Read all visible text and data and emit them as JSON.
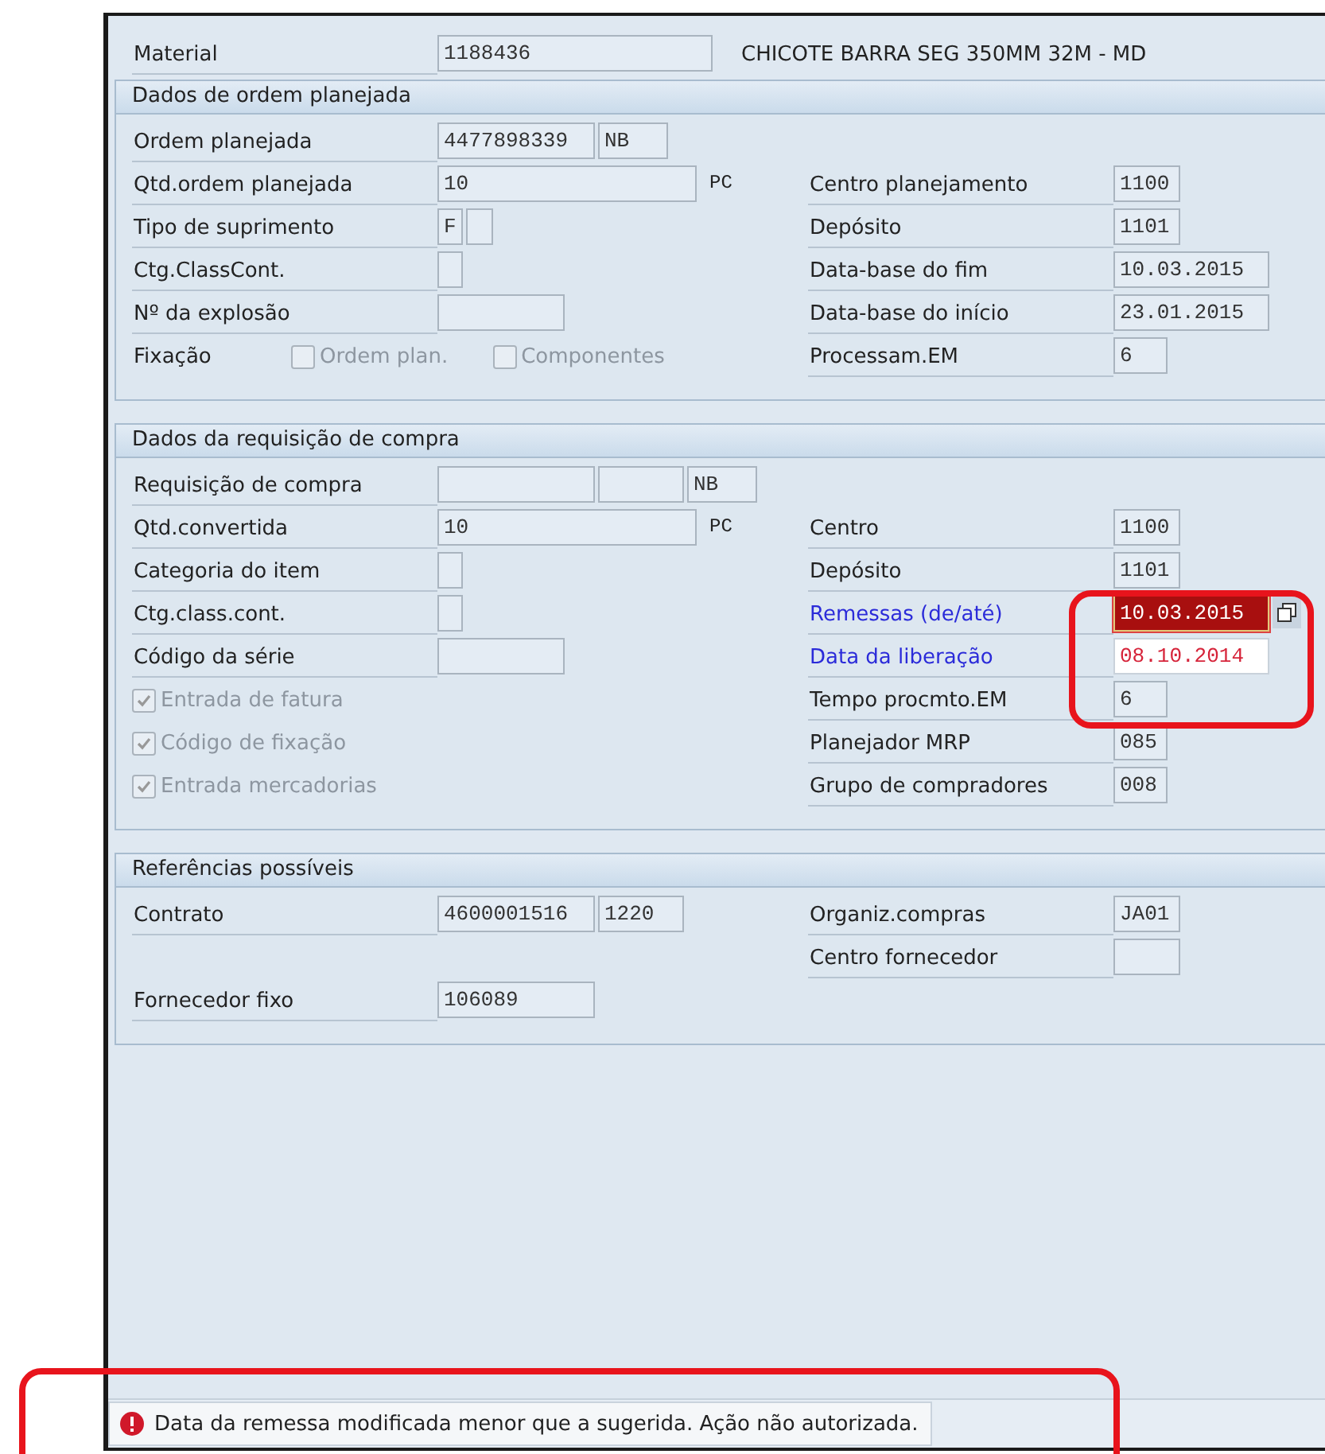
{
  "material": {
    "label": "Material",
    "value": "1188436",
    "description": "CHICOTE BARRA SEG 350MM 32M - MD"
  },
  "sections": [
    {
      "title": "Dados de ordem planejada",
      "rows": [
        {
          "left": {
            "kind": "field",
            "label": "Ordem planejada",
            "fields": [
              {
                "value": "4477898339",
                "error": false,
                "warning": false
              },
              {
                "value": "NB",
                "error": false,
                "warning": false
              }
            ]
          }
        },
        {
          "left": {
            "kind": "field",
            "label": "Qtd.ordem planejada",
            "fields": [
              {
                "value": "10",
                "error": false,
                "warning": false
              }
            ],
            "unit": "PC"
          },
          "right": {
            "kind": "field",
            "label": "Centro planejamento",
            "fields": [
              {
                "value": "1100",
                "error": false,
                "warning": false
              }
            ]
          }
        },
        {
          "left": {
            "kind": "field",
            "label": "Tipo de suprimento",
            "fields": [
              {
                "value": "F",
                "error": false,
                "warning": false
              },
              {
                "error": false,
                "warning": false
              }
            ]
          },
          "right": {
            "kind": "field",
            "label": "Depósito",
            "fields": [
              {
                "value": "1101",
                "error": false,
                "warning": false
              }
            ]
          }
        },
        {
          "left": {
            "kind": "field",
            "label": "Ctg.ClassCont.",
            "fields": [
              {
                "error": false,
                "warning": false
              }
            ]
          },
          "right": {
            "kind": "field",
            "label": "Data-base do fim",
            "fields": [
              {
                "value": "10.03.2015",
                "error": false,
                "warning": false
              }
            ]
          }
        },
        {
          "left": {
            "kind": "field",
            "label": "Nº da explosão",
            "fields": [
              {
                "error": false,
                "warning": false
              }
            ]
          },
          "right": {
            "kind": "field",
            "label": "Data-base do início",
            "fields": [
              {
                "value": "23.01.2015",
                "error": false,
                "warning": false
              }
            ]
          }
        },
        {
          "left": {
            "kind": "options",
            "label": "Fixação",
            "options": [
              {
                "label": "Ordem plan.",
                "checked": false,
                "disabled": true
              },
              {
                "label": "Componentes",
                "checked": false,
                "disabled": true
              }
            ]
          },
          "right": {
            "kind": "field",
            "label": "Processam.EM",
            "fields": [
              {
                "value": "6",
                "error": false,
                "warning": false
              }
            ]
          }
        }
      ]
    },
    {
      "title": "Dados da requisição de compra",
      "rows": [
        {
          "left": {
            "kind": "field",
            "label": "Requisição de compra",
            "fields": [
              {
                "error": false,
                "warning": false
              },
              {
                "error": false,
                "warning": false
              },
              {
                "value": "NB",
                "error": false,
                "warning": false
              }
            ]
          }
        },
        {
          "left": {
            "kind": "field",
            "label": "Qtd.convertida",
            "fields": [
              {
                "value": "10",
                "error": false,
                "warning": false
              }
            ],
            "unit": "PC"
          },
          "right": {
            "kind": "field",
            "label": "Centro",
            "fields": [
              {
                "value": "1100",
                "error": false,
                "warning": false
              }
            ]
          }
        },
        {
          "left": {
            "kind": "field",
            "label": "Categoria do item",
            "fields": [
              {
                "error": false,
                "warning": false
              }
            ]
          },
          "right": {
            "kind": "field",
            "label": "Depósito",
            "fields": [
              {
                "value": "1101",
                "error": false,
                "warning": false
              }
            ]
          }
        },
        {
          "left": {
            "kind": "field",
            "label": "Ctg.class.cont.",
            "fields": [
              {
                "error": false,
                "warning": false
              }
            ]
          },
          "right": {
            "kind": "field",
            "label": "Remessas (de/até)",
            "color": "#2b2bd9",
            "fields": [
              {
                "value": "10.03.2015",
                "error": true,
                "warning": false
              }
            ],
            "multiple_selection": true
          }
        },
        {
          "left": {
            "kind": "field",
            "label": "Código da série",
            "fields": [
              {
                "error": false,
                "warning": false
              }
            ]
          },
          "right": {
            "kind": "field",
            "label": "Data da liberação",
            "color": "#2b2bd9",
            "fields": [
              {
                "value": "08.10.2014",
                "error": false,
                "warning": true
              }
            ]
          }
        },
        {
          "left": {
            "kind": "checkbox",
            "label": "Entrada de fatura",
            "checked": true,
            "disabled": true
          },
          "right": {
            "kind": "field",
            "label": "Tempo procmto.EM",
            "fields": [
              {
                "value": "6",
                "error": false,
                "warning": false
              }
            ]
          }
        },
        {
          "left": {
            "kind": "checkbox",
            "label": "Código de fixação",
            "checked": true,
            "disabled": true
          },
          "right": {
            "kind": "field",
            "label": "Planejador MRP",
            "fields": [
              {
                "value": "085",
                "error": false,
                "warning": false
              }
            ]
          }
        },
        {
          "left": {
            "kind": "checkbox",
            "label": "Entrada mercadorias",
            "checked": true,
            "disabled": true
          },
          "right": {
            "kind": "field",
            "label": "Grupo de compradores",
            "fields": [
              {
                "value": "008",
                "error": false,
                "warning": false
              }
            ]
          }
        }
      ]
    },
    {
      "title": "Referências possíveis",
      "rows": [
        {
          "left": {
            "kind": "field",
            "label": "Contrato",
            "fields": [
              {
                "value": "4600001516",
                "error": false,
                "warning": false
              },
              {
                "value": "1220",
                "error": false,
                "warning": false
              }
            ]
          },
          "right": {
            "kind": "field",
            "label": "Organiz.compras",
            "fields": [
              {
                "value": "JA01",
                "error": false,
                "warning": false
              }
            ]
          }
        },
        {
          "right": {
            "kind": "field",
            "label": "Centro fornecedor",
            "fields": [
              {
                "error": false,
                "warning": false
              }
            ]
          }
        },
        {
          "left": {
            "kind": "field",
            "label": "Fornecedor fixo",
            "fields": [
              {
                "value": "106089",
                "error": false,
                "warning": false
              }
            ]
          }
        }
      ]
    }
  ],
  "status": {
    "error": true,
    "text": "Data da remessa modificada menor que a sugerida. Ação não autorizada."
  }
}
